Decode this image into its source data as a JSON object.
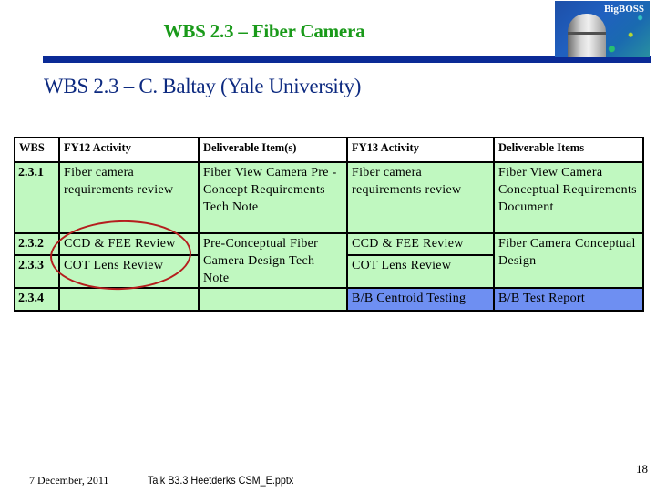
{
  "slide": {
    "title": "WBS 2.3 – Fiber Camera",
    "subtitle": "WBS 2.3 – C. Baltay (Yale University)",
    "logo_text": "BigBOSS",
    "colors": {
      "title": "#1a9a1a",
      "title_bar": "#0a2a96",
      "subtitle": "#0d2a80",
      "row_green": "#c0f8c0",
      "row_blue": "#6e8ff2",
      "highlight_ellipse": "#b51e1e"
    }
  },
  "table": {
    "headers": [
      "WBS",
      "FY12 Activity",
      "Deliverable Item(s)",
      "FY13 Activity",
      "Deliverable Items"
    ],
    "rows": [
      {
        "wbs": "2.3.1",
        "fy12_activity": "Fiber camera requirements review",
        "fy12_deliverable": "Fiber View Camera Pre -Concept Requirements Tech Note",
        "fy13_activity": "Fiber camera requirements review",
        "fy13_deliverable": "Fiber View Camera Conceptual Requirements Document"
      },
      {
        "wbs": "2.3.2",
        "fy12_activity": "CCD & FEE Review",
        "fy12_deliverable": "Pre-Conceptual Fiber Camera Design Tech Note",
        "fy13_activity": "CCD & FEE Review",
        "fy13_deliverable": "Fiber Camera Conceptual Design"
      },
      {
        "wbs": "2.3.3",
        "fy12_activity": "COT Lens Review",
        "fy13_activity": "COT Lens Review"
      },
      {
        "wbs": "2.3.4",
        "fy12_activity": "",
        "fy12_deliverable": "",
        "fy13_activity": "B/B Centroid Testing",
        "fy13_deliverable": "B/B Test Report"
      }
    ]
  },
  "footer": {
    "date": "7 December,  2011",
    "file": "Talk B3.3 Heetderks CSM_E.pptx",
    "page_number": "18"
  }
}
